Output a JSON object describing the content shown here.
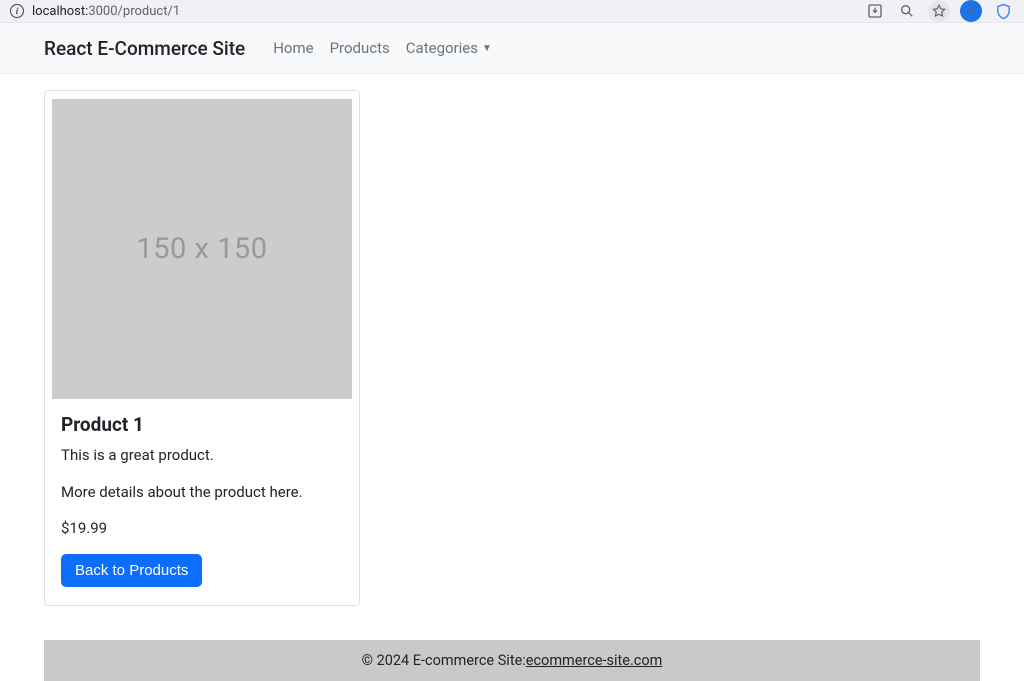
{
  "browser": {
    "url_host": "localhost:",
    "url_rest": "3000/product/1"
  },
  "nav": {
    "brand": "React E-Commerce Site",
    "links": {
      "home": "Home",
      "products": "Products",
      "categories": "Categories"
    }
  },
  "product": {
    "placeholder_text": "150 x 150",
    "title": "Product 1",
    "description": "This is a great product.",
    "details": "More details about the product here.",
    "price": "$19.99",
    "back_button": "Back to Products"
  },
  "footer": {
    "prefix": "© 2024 E-commerce Site:",
    "link_text": "ecommerce-site.com"
  }
}
